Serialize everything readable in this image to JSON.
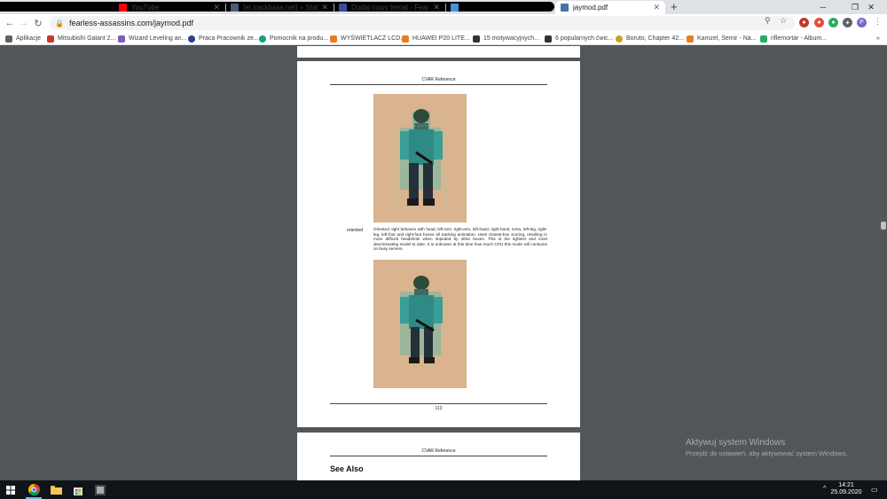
{
  "browser": {
    "tabs": [
      {
        "title": "YouTube",
        "color": "#ff0000"
      },
      {
        "title": "[et.trackbase.net] » Statistics fo",
        "color": "#4c5a78"
      },
      {
        "title": "Dodaj nowy temat - Fearless As",
        "color": "#3b4a9c"
      },
      {
        "title": "",
        "color": "#4a90d9"
      },
      {
        "title": "jaymod.pdf",
        "color": "#4c6fa5"
      }
    ],
    "active_tab_index": 4,
    "new_tab_symbol": "+",
    "address": "fearless-assassins.com/jaymod.pdf",
    "profile_letter": "P"
  },
  "bookmarks": [
    {
      "label": "Aplikacje",
      "color": "#5f6368"
    },
    {
      "label": "Mitsubishi Galant 2...",
      "color": "#c0392b"
    },
    {
      "label": "Wizard Leveling an...",
      "color": "#7d5fb2"
    },
    {
      "label": "Praca Pracownik ze...",
      "color": "#2c3e90"
    },
    {
      "label": "Pomocnik na produ...",
      "color": "#16a085"
    },
    {
      "label": "WYŚWIETLACZ LCD...",
      "color": "#e67e22"
    },
    {
      "label": "HUAWEI P20 LITE...",
      "color": "#e67e22"
    },
    {
      "label": "15 motywacyjnych...",
      "color": "#2d3436"
    },
    {
      "label": "6 popularnych ćwic...",
      "color": "#2d3436"
    },
    {
      "label": "Boruto, Chapter 42...",
      "color": "#c9a227"
    },
    {
      "label": "Kamzel, Semir - Na...",
      "color": "#e67e22"
    },
    {
      "label": "riflemortar - Album...",
      "color": "#27ae60"
    }
  ],
  "pdf": {
    "running_header": "CVAR Reference",
    "term": "oriented",
    "description": "Oriented, tight behavior with head, left-arm, right-arm, left-hand, right-hand, torso, left-leg, right-leg, left-foot and right-foot boxes all tracking animation. Uses closest-box scoring, resulting in more difficult headshots when impeded by other boxes. This is the tightest and most discriminating model to date. It is unknown at this time how much CPU this mode will consume on busy servers.",
    "page_number": "113",
    "next_page_section": "See Also",
    "figure_bg": "#d9b48e"
  },
  "watermark": {
    "title": "Aktywuj system Windows",
    "subtitle": "Przejdź do ustawień, aby aktywować system Windows."
  },
  "taskbar": {
    "time": "14:21",
    "date": "25.09.2020"
  }
}
